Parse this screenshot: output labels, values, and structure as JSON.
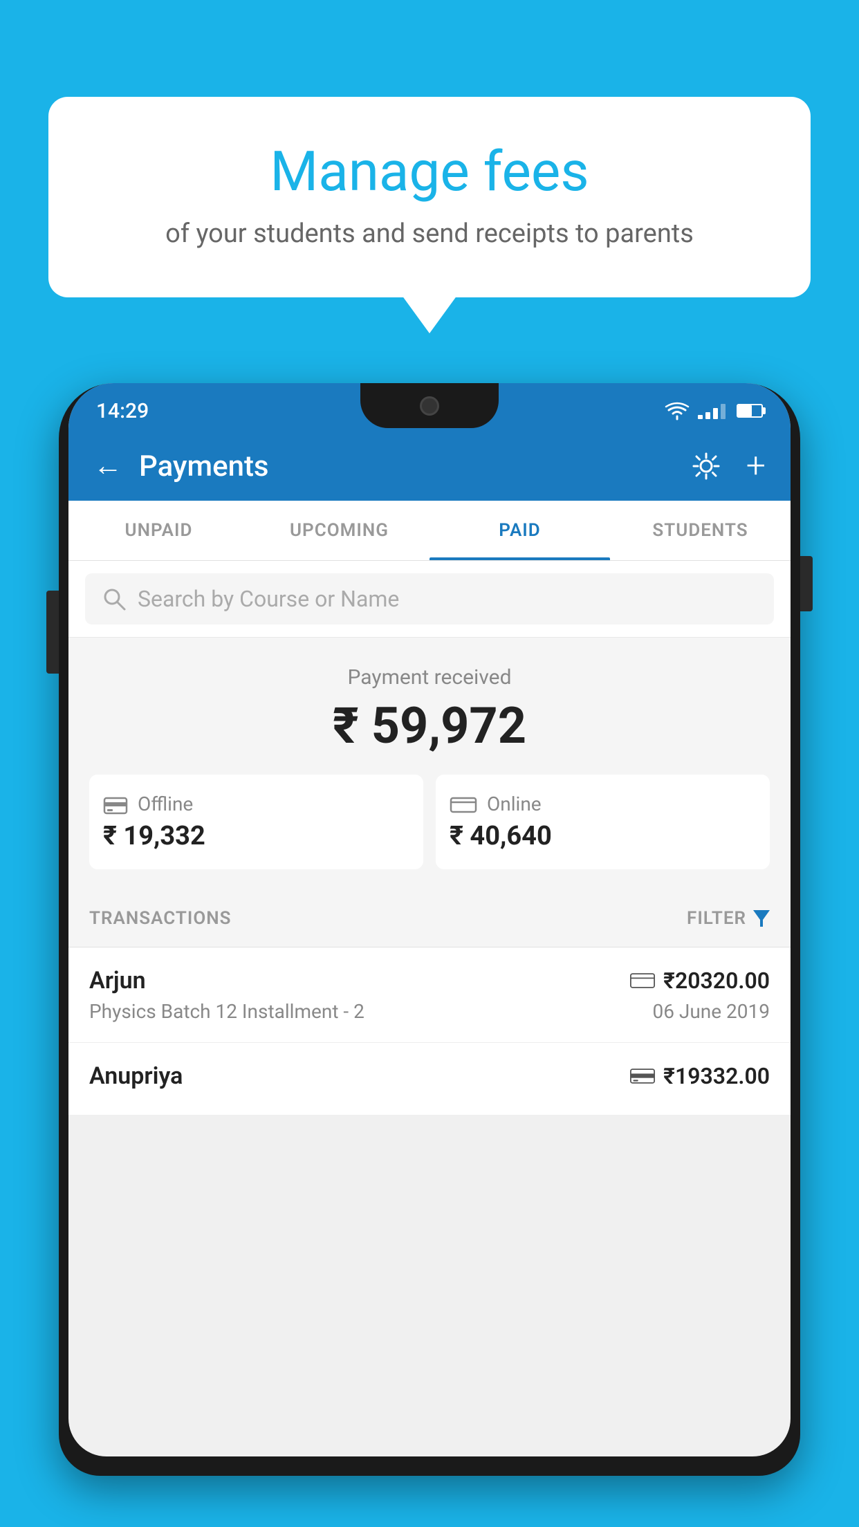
{
  "background_color": "#1ab3e8",
  "bubble": {
    "title": "Manage fees",
    "subtitle": "of your students and send receipts to parents"
  },
  "status_bar": {
    "time": "14:29"
  },
  "header": {
    "title": "Payments",
    "back_label": "←",
    "plus_label": "+"
  },
  "tabs": [
    {
      "id": "unpaid",
      "label": "UNPAID",
      "active": false
    },
    {
      "id": "upcoming",
      "label": "UPCOMING",
      "active": false
    },
    {
      "id": "paid",
      "label": "PAID",
      "active": true
    },
    {
      "id": "students",
      "label": "STUDENTS",
      "active": false
    }
  ],
  "search": {
    "placeholder": "Search by Course or Name"
  },
  "payment_summary": {
    "label": "Payment received",
    "total": "₹ 59,972",
    "offline_label": "Offline",
    "offline_amount": "₹ 19,332",
    "online_label": "Online",
    "online_amount": "₹ 40,640"
  },
  "transactions": {
    "header_label": "TRANSACTIONS",
    "filter_label": "FILTER",
    "rows": [
      {
        "name": "Arjun",
        "amount": "₹20320.00",
        "course": "Physics Batch 12 Installment - 2",
        "date": "06 June 2019",
        "payment_type": "online"
      },
      {
        "name": "Anupriya",
        "amount": "₹19332.00",
        "course": "",
        "date": "",
        "payment_type": "offline"
      }
    ]
  }
}
